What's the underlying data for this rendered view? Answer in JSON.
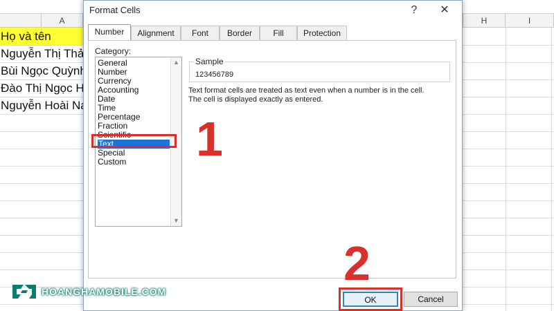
{
  "spreadsheet": {
    "column_a_header": "A",
    "column_h_header": "H",
    "column_i_header": "I",
    "rows": [
      "Họ và tên",
      "Nguyễn Thị Thả",
      "Bùi Ngọc Quỳnh",
      "Đào Thị Ngọc H",
      "Nguyễn Hoài Na"
    ]
  },
  "dialog": {
    "title": "Format Cells",
    "help_button": "?",
    "close_button": "✕",
    "tabs": [
      "Number",
      "Alignment",
      "Font",
      "Border",
      "Fill",
      "Protection"
    ],
    "active_tab": "Number",
    "category_label": "Category:",
    "categories": [
      "General",
      "Number",
      "Currency",
      "Accounting",
      "Date",
      "Time",
      "Percentage",
      "Fraction",
      "Scientific",
      "Text",
      "Special",
      "Custom"
    ],
    "selected_category": "Text",
    "sample_label": "Sample",
    "sample_value": "123456789",
    "description_line1": "Text format cells are treated as text even when a number is in the cell.",
    "description_line2": "The cell is displayed exactly as entered.",
    "ok_label": "OK",
    "cancel_label": "Cancel"
  },
  "annotations": {
    "step1": "1",
    "step2": "2",
    "highlight_color": "#d9302c"
  },
  "branding": {
    "logo_text": "HOANGHAMOBILE.COM",
    "logo_color": "#0a7e6f"
  },
  "colors": {
    "header_fill": "#ffff33",
    "selection": "#1a73d9",
    "ok_border": "#3c7fc1"
  }
}
